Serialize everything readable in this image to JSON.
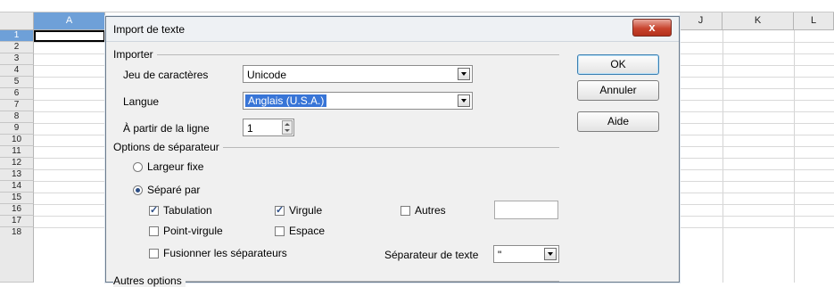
{
  "spreadsheet": {
    "columns": {
      "A": "A",
      "J": "J",
      "K": "K",
      "L": "L"
    },
    "rows": [
      "1",
      "2",
      "3",
      "4",
      "5",
      "6",
      "7",
      "8",
      "9",
      "10",
      "11",
      "12",
      "13",
      "14",
      "15",
      "16",
      "17",
      "18"
    ]
  },
  "dialog": {
    "title": "Import de texte",
    "close": "x",
    "importer": {
      "section": "Importer",
      "charset_label": "Jeu de caractères",
      "charset_value": "Unicode",
      "language_label": "Langue",
      "language_value": "Anglais (U.S.A.)",
      "from_line_label": "À partir de la ligne",
      "from_line_value": "1"
    },
    "buttons": {
      "ok": "OK",
      "cancel": "Annuler",
      "help": "Aide"
    },
    "separator_options": {
      "section": "Options de séparateur",
      "fixed_width": "Largeur fixe",
      "separated_by": "Séparé par",
      "tab": "Tabulation",
      "comma": "Virgule",
      "other": "Autres",
      "semicolon": "Point-virgule",
      "space": "Espace",
      "merge": "Fusionner les séparateurs",
      "text_delimiter_label": "Séparateur de texte",
      "text_delimiter_value": "\""
    },
    "other_options": {
      "section": "Autres options"
    }
  }
}
